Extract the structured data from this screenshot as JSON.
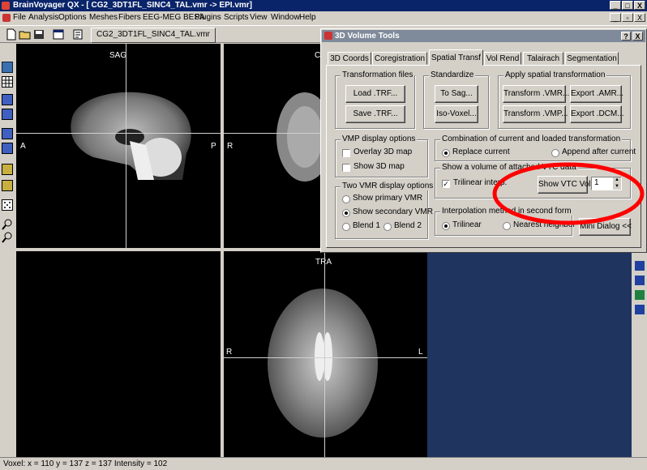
{
  "app": {
    "title": "BrainVoyager QX - [ CG2_3DT1FL_SINC4_TAL.vmr -> EPI.vmr]",
    "win_min": "_",
    "win_max": "□",
    "win_close": "X",
    "mdi_min": "_",
    "mdi_restore": "▫",
    "mdi_close": "X"
  },
  "menu": [
    "File",
    "Analysis",
    "Options",
    "Meshes",
    "Fibers",
    "EEG-MEG BESA",
    "Plugins",
    "Scripts",
    "View",
    "Window",
    "Help"
  ],
  "toolbar": {
    "doc_tab": "CG2_3DT1FL_SINC4_TAL.vmr"
  },
  "views": {
    "sagittal": {
      "title": "SAG",
      "left": "A",
      "right": "P"
    },
    "coronal": {
      "title": "C",
      "left": "R"
    },
    "transversal": {
      "title": "TRA",
      "left": "R",
      "right": "L"
    }
  },
  "dialog": {
    "title": "3D Volume Tools",
    "help": "?",
    "close": "X",
    "tabs": [
      "3D Coords",
      "Coregistration",
      "Spatial Transf",
      "Vol Rend",
      "Talairach",
      "Segmentation"
    ],
    "active_tab": "Spatial Transf",
    "transformation_files": {
      "label": "Transformation files",
      "load": "Load .TRF...",
      "save": "Save .TRF..."
    },
    "standardize": {
      "label": "Standardize",
      "to_sag": "To Sag...",
      "iso_voxel": "Iso-Voxel..."
    },
    "apply_spatial": {
      "label": "Apply spatial transformation",
      "transform_vmr": "Transform .VMR...",
      "export_amr": "Export .AMR...",
      "transform_vmp": "Transform .VMP...",
      "export_dcm": "Export .DCM..."
    },
    "vmp_display": {
      "label": "VMP display options",
      "overlay": "Overlay 3D map",
      "overlay_checked": false,
      "show3d": "Show 3D map",
      "show3d_checked": false
    },
    "combination": {
      "label": "Combination of current and loaded transformation",
      "replace": "Replace current",
      "append": "Append after current",
      "selected": "replace"
    },
    "show_volume": {
      "label": "Show a volume of attached VTC data",
      "trilinear": "Trilinear interp.",
      "trilinear_checked": true,
      "show_vtc_button": "Show VTC Vol",
      "volume_index": "1"
    },
    "two_vmr": {
      "label": "Two VMR display options",
      "primary": "Show primary VMR",
      "secondary": "Show secondary VMR",
      "blend1": "Blend 1",
      "blend2": "Blend 2",
      "selected": "secondary"
    },
    "interp_method": {
      "label": "Interpolation method in second form",
      "trilinear": "Trilinear",
      "nearest": "Nearest neighbor",
      "selected": "trilinear"
    },
    "mini_dialog_button": "Mini Dialog <<"
  },
  "annotation": {
    "color": "#ff0000",
    "shape": "ellipse"
  },
  "status": {
    "text": "Voxel:  x = 110 y = 137 z = 137  Intensity = 102"
  },
  "colors": {
    "titlebar": "#0a246a",
    "dialog_title": "#7f8a9a",
    "workspace": "#1f3560"
  }
}
